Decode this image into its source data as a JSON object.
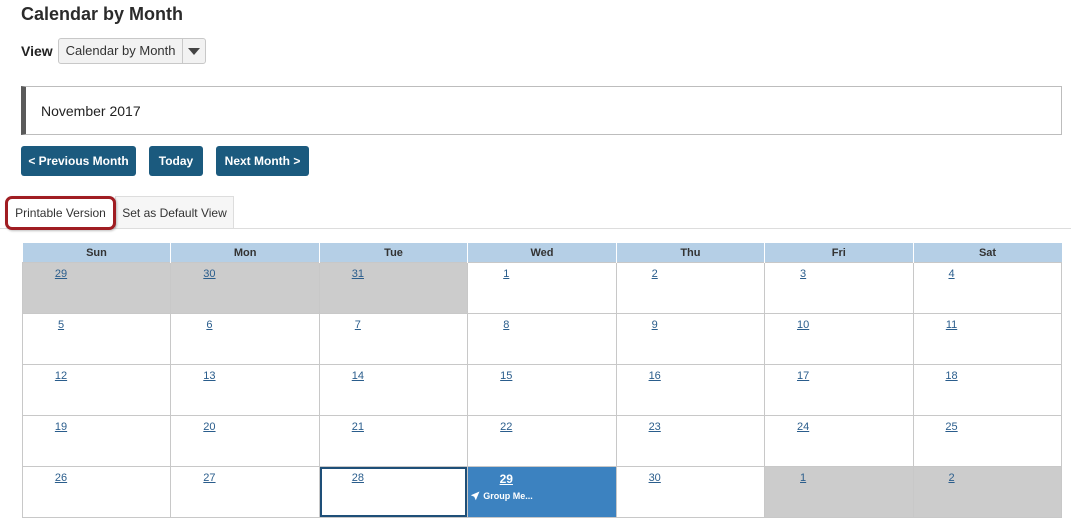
{
  "page": {
    "title": "Calendar by Month"
  },
  "view": {
    "label": "View",
    "selected": "Calendar by Month"
  },
  "month": {
    "label": "November 2017"
  },
  "nav": {
    "prev_label": "< Previous Month",
    "today_label": "Today",
    "next_label": "Next Month >"
  },
  "tabs": {
    "printable": "Printable Version",
    "default_view": "Set as Default View"
  },
  "calendar": {
    "days": [
      "Sun",
      "Mon",
      "Tue",
      "Wed",
      "Thu",
      "Fri",
      "Sat"
    ],
    "weeks": [
      [
        {
          "n": "29",
          "other": true
        },
        {
          "n": "30",
          "other": true
        },
        {
          "n": "31",
          "other": true
        },
        {
          "n": "1"
        },
        {
          "n": "2"
        },
        {
          "n": "3"
        },
        {
          "n": "4"
        }
      ],
      [
        {
          "n": "5"
        },
        {
          "n": "6"
        },
        {
          "n": "7"
        },
        {
          "n": "8"
        },
        {
          "n": "9"
        },
        {
          "n": "10"
        },
        {
          "n": "11"
        }
      ],
      [
        {
          "n": "12"
        },
        {
          "n": "13"
        },
        {
          "n": "14"
        },
        {
          "n": "15"
        },
        {
          "n": "16"
        },
        {
          "n": "17"
        },
        {
          "n": "18"
        }
      ],
      [
        {
          "n": "19"
        },
        {
          "n": "20"
        },
        {
          "n": "21"
        },
        {
          "n": "22"
        },
        {
          "n": "23"
        },
        {
          "n": "24"
        },
        {
          "n": "25"
        }
      ],
      [
        {
          "n": "26"
        },
        {
          "n": "27"
        },
        {
          "n": "28",
          "today": true
        },
        {
          "n": "29",
          "selected": true,
          "event": "Group Me..."
        },
        {
          "n": "30"
        },
        {
          "n": "1",
          "other": true
        },
        {
          "n": "2",
          "other": true
        }
      ]
    ]
  },
  "colors": {
    "header_bg": "#b5cfe6",
    "button_bg": "#1b5a7e",
    "selected_cell": "#3c82c0",
    "other_month": "#cccccc",
    "highlight_ring": "#a01d22"
  },
  "icons": {
    "event": "rocket-icon",
    "dropdown": "chevron-down-icon"
  }
}
